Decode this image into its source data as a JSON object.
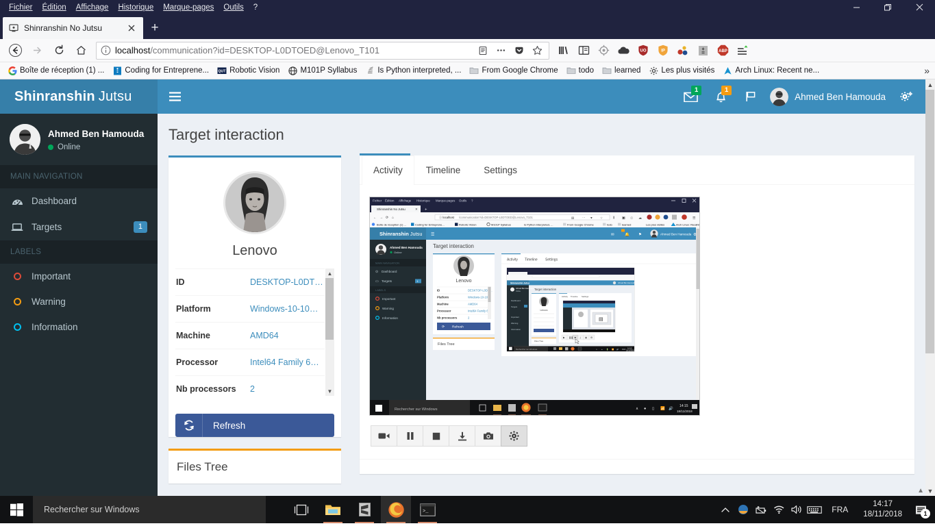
{
  "window": {
    "menus": [
      "Fichier",
      "Édition",
      "Affichage",
      "Historique",
      "Marque-pages",
      "Outils",
      "?"
    ],
    "controls": {
      "minimize": "minimize-icon",
      "maximize": "maximize-icon",
      "close": "close-icon"
    }
  },
  "browser": {
    "tab": {
      "title": "Shinranshin No Jutsu",
      "favicon": "monitor-icon",
      "close": "close-icon"
    },
    "new_tab_label": "+",
    "nav": {
      "back": "back-arrow-icon",
      "forward": "forward-arrow-icon",
      "reload": "reload-icon",
      "home": "home-icon"
    },
    "url": {
      "host": "localhost",
      "rest": "/communication?id=DESKTOP-L0DTOED@Lenovo_T101",
      "full": "localhost/communication?id=DESKTOP-L0DTOED@Lenovo_T101"
    },
    "url_icons": [
      "reader-view-icon",
      "page-actions-icon",
      "pocket-icon",
      "bookmark-star-icon"
    ],
    "toolbar_extensions": [
      "library-icon",
      "sidebar-icon",
      "target-icon",
      "cloud-icon",
      "ublock-origin-icon",
      "ip-shield-icon",
      "molecule-icon",
      "grey-extension-icon",
      "adblock-plus-icon",
      "menu-hamburger-icon"
    ],
    "bookmarks": [
      {
        "label": "Boîte de réception (1) ...",
        "icon": "google-icon"
      },
      {
        "label": "Coding for Entreprene...",
        "icon": "blue-square-icon"
      },
      {
        "label": "Robotic Vision",
        "icon": "qut-icon"
      },
      {
        "label": "M101P Syllabus",
        "icon": "globe-icon"
      },
      {
        "label": "Is Python interpreted, ...",
        "icon": "stackoverflow-icon"
      },
      {
        "label": "From Google Chrome",
        "icon": "folder-icon"
      },
      {
        "label": "todo",
        "icon": "folder-icon"
      },
      {
        "label": "learned",
        "icon": "folder-icon"
      },
      {
        "label": "Les plus visités",
        "icon": "gear-icon"
      },
      {
        "label": "Arch Linux: Recent ne...",
        "icon": "arch-linux-icon"
      }
    ],
    "bookmarks_overflow": "»"
  },
  "app": {
    "brand": {
      "bold": "Shinranshin",
      "normal": "Jutsu"
    },
    "hamburger": "hamburger-icon",
    "header_icons": [
      {
        "name": "envelope-icon",
        "badge": "1",
        "badge_color": "#00a65a"
      },
      {
        "name": "bell-icon",
        "badge": "1",
        "badge_color": "#f39c12"
      },
      {
        "name": "flag-icon",
        "badge": "",
        "badge_color": ""
      }
    ],
    "header_user": "Ahmed Ben Hamouda",
    "header_gear": "gears-icon",
    "accent": "#3c8dbc"
  },
  "sidebar": {
    "user": {
      "name": "Ahmed Ben Hamouda",
      "status": "Online",
      "status_color": "#00a65a"
    },
    "sections": [
      {
        "header": "MAIN NAVIGATION",
        "items": [
          {
            "label": "Dashboard",
            "icon": "dashboard-icon",
            "badge": ""
          },
          {
            "label": "Targets",
            "icon": "laptop-icon",
            "badge": "1"
          }
        ]
      },
      {
        "header": "LABELS",
        "items": [
          {
            "label": "Important",
            "icon": "circle-icon",
            "color": "#dd4b39"
          },
          {
            "label": "Warning",
            "icon": "circle-icon",
            "color": "#f39c12"
          },
          {
            "label": "Information",
            "icon": "circle-icon",
            "color": "#00c0ef"
          }
        ]
      }
    ]
  },
  "main": {
    "page_title": "Target interaction",
    "profile": {
      "name": "Lenovo",
      "avatar": "target-avatar",
      "details": [
        {
          "key": "ID",
          "value": "DESKTOP-L0DT…"
        },
        {
          "key": "Platform",
          "value": "Windows-10-10…"
        },
        {
          "key": "Machine",
          "value": "AMD64"
        },
        {
          "key": "Processor",
          "value": "Intel64 Family 6…"
        },
        {
          "key": "Nb processors",
          "value": "2"
        }
      ],
      "refresh_label": "Refresh",
      "refresh_icon": "sync-icon"
    },
    "files_tree_title": "Files Tree",
    "tabs": [
      {
        "label": "Activity",
        "active": true
      },
      {
        "label": "Timeline",
        "active": false
      },
      {
        "label": "Settings",
        "active": false
      }
    ],
    "stream_controls": [
      {
        "name": "record-video-icon",
        "pressed": false
      },
      {
        "name": "pause-icon",
        "pressed": false
      },
      {
        "name": "stop-icon",
        "pressed": false
      },
      {
        "name": "download-icon",
        "pressed": false
      },
      {
        "name": "screenshot-camera-icon",
        "pressed": false
      },
      {
        "name": "settings-gear-icon",
        "pressed": true
      }
    ]
  },
  "taskbar": {
    "start": "windows-start-icon",
    "search_placeholder": "Rechercher sur Windows",
    "apps": [
      {
        "name": "task-view-icon",
        "active": false,
        "open": false
      },
      {
        "name": "file-explorer-icon",
        "active": false,
        "open": true
      },
      {
        "name": "sublime-text-icon",
        "active": false,
        "open": true
      },
      {
        "name": "firefox-icon",
        "active": true,
        "open": true
      },
      {
        "name": "terminal-icon",
        "active": false,
        "open": true
      }
    ],
    "tray": [
      "show-hidden-icons-icon",
      "app-circle-icon",
      "battery-icon",
      "wifi-icon",
      "volume-icon",
      "keyboard-icon"
    ],
    "language": "FRA",
    "time": "14:17",
    "date": "18/11/2018",
    "notifications": {
      "icon": "action-center-icon",
      "count": "1"
    }
  }
}
